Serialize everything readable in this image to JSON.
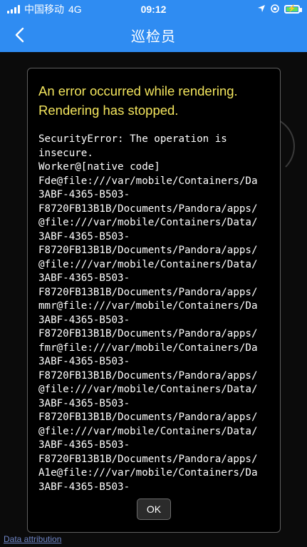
{
  "status_bar": {
    "carrier": "中国移动",
    "network": "4G",
    "time": "09:12",
    "battery_color": "#5ee15e"
  },
  "nav": {
    "title": "巡检员",
    "back_icon": "chevron-left-icon",
    "color": "#2f8cf2"
  },
  "dialog": {
    "title": "An error occurred while rendering.\nRendering has stopped.",
    "message": "SecurityError: The operation is\ninsecure.\nWorker@[native code]\nFde@file:///var/mobile/Containers/Da\n3ABF-4365-B503-\nF8720FB13B1B/Documents/Pandora/apps/\n@file:///var/mobile/Containers/Data/\n3ABF-4365-B503-\nF8720FB13B1B/Documents/Pandora/apps/\n@file:///var/mobile/Containers/Data/\n3ABF-4365-B503-\nF8720FB13B1B/Documents/Pandora/apps/\nmmr@file:///var/mobile/Containers/Da\n3ABF-4365-B503-\nF8720FB13B1B/Documents/Pandora/apps/\nfmr@file:///var/mobile/Containers/Da\n3ABF-4365-B503-\nF8720FB13B1B/Documents/Pandora/apps/\n@file:///var/mobile/Containers/Data/\n3ABF-4365-B503-\nF8720FB13B1B/Documents/Pandora/apps/\n@file:///var/mobile/Containers/Data/\n3ABF-4365-B503-\nF8720FB13B1B/Documents/Pandora/apps/\nA1e@file:///var/mobile/Containers/Da\n3ABF-4365-B503-",
    "ok_label": "OK",
    "title_color": "#f3e55d"
  },
  "footer": {
    "attribution": "Data attribution"
  }
}
